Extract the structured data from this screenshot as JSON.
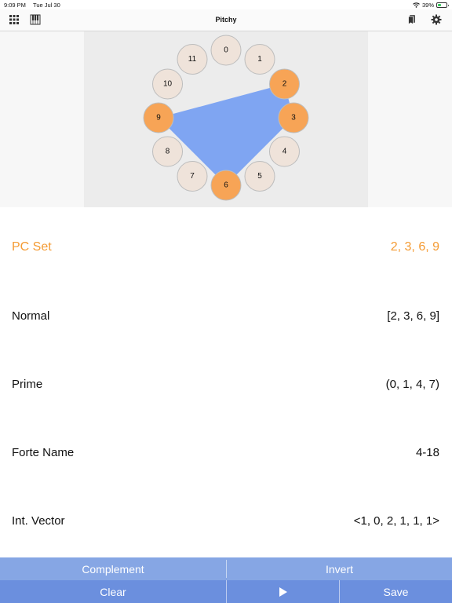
{
  "status_bar": {
    "time": "9:09 PM",
    "date": "Tue Jul 30",
    "battery": "39%",
    "battery_level": 0.39
  },
  "nav": {
    "title": "Pitchy",
    "icons": [
      "grid-icon",
      "piano-icon",
      "bookmarks-icon",
      "gear-icon"
    ]
  },
  "clock": {
    "pitch_classes": [
      "0",
      "1",
      "2",
      "3",
      "4",
      "5",
      "6",
      "7",
      "8",
      "9",
      "10",
      "11"
    ],
    "selected": [
      2,
      3,
      6,
      9
    ],
    "colors": {
      "selected": "#f7a456",
      "unselected": "#efe3da",
      "polygon": "#7fa5f2"
    }
  },
  "info": {
    "pc_set": {
      "label": "PC Set",
      "value": "2, 3, 6, 9"
    },
    "normal": {
      "label": "Normal",
      "value": "[2, 3, 6, 9]"
    },
    "prime": {
      "label": "Prime",
      "value": "(0, 1, 4, 7)"
    },
    "forte": {
      "label": "Forte Name",
      "value": "4-18"
    },
    "vector": {
      "label": "Int. Vector",
      "value": "<1, 0, 2, 1, 1, 1>"
    }
  },
  "toolbar": {
    "complement": "Complement",
    "invert": "Invert",
    "clear": "Clear",
    "play_icon": "play-icon",
    "save": "Save",
    "colors": {
      "row1": "#86a6e4",
      "row2": "#6b8fde"
    }
  },
  "accent_color": "#f49b34"
}
